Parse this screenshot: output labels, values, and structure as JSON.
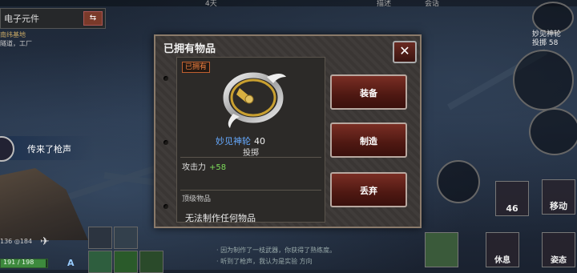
{
  "hud": {
    "top_left_partial": "4天",
    "top_mid_partial": "描述",
    "top_right_partial": "会话"
  },
  "task": {
    "title": "电子元件",
    "swap_icon": "swap-icon"
  },
  "location": {
    "line1": "南纬基地",
    "line2": "隧道，工厂"
  },
  "notification": {
    "text": "传来了枪声"
  },
  "player": {
    "stat1": "136",
    "stat2": "184",
    "hp": "191 / 198"
  },
  "log": {
    "line1": "· 因为制作了一枝武器，你获得了熟练度。",
    "line2": "· 听到了枪声，我认为是实验 方向"
  },
  "right_hud": {
    "name": "妙见神轮",
    "type_num": "投掷 58",
    "map_count": "46",
    "move": "移动",
    "rest": "休息",
    "pose": "姿态"
  },
  "dialog": {
    "title": "已拥有物品",
    "close_icon": "close-icon",
    "owned_badge": "已拥有",
    "item_name": "妙见神轮",
    "item_level": "40",
    "item_type": "投掷",
    "stat_label": "攻击力",
    "stat_value": "+58",
    "section_label": "顶级物品",
    "craft_none": "无法制作任何物品",
    "buttons": {
      "equip": "装备",
      "craft": "制造",
      "discard": "丢弃"
    }
  },
  "colors": {
    "item_name": "#66aaff",
    "stat_value": "#7ddc5a",
    "owned_badge": "#f08040",
    "button": "#7a2e24"
  }
}
